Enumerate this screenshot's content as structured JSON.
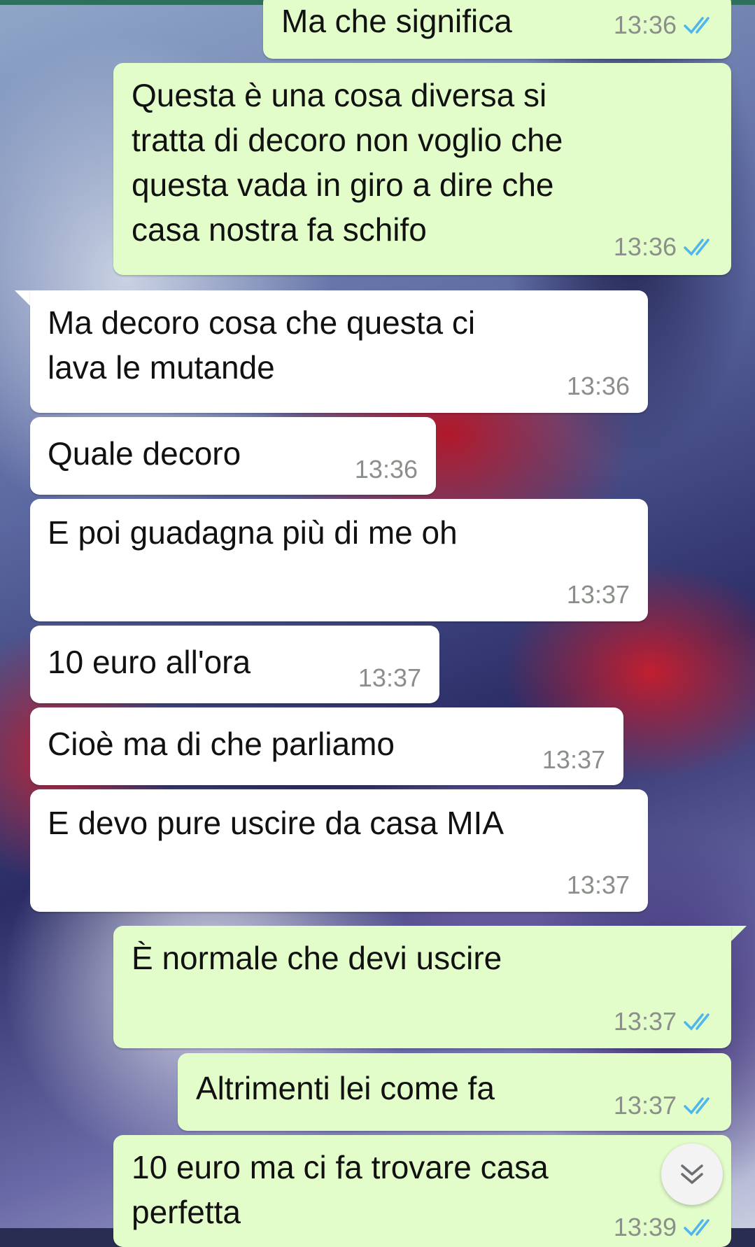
{
  "colors": {
    "outgoing_bubble": "#e2fdca",
    "incoming_bubble": "#ffffff",
    "read_ticks": "#4fb6ec",
    "timestamp": "#8b8f8a"
  },
  "messages": [
    {
      "direction": "out",
      "text": "Ma che significa",
      "time": "13:36",
      "status_icon": "double-check-read-icon"
    },
    {
      "direction": "out",
      "text": "Questa è una cosa diversa si\ntratta di decoro non voglio che\nquesta vada in giro a dire che\ncasa nostra fa schifo",
      "time": "13:36",
      "status_icon": "double-check-read-icon"
    },
    {
      "direction": "in",
      "text": "Ma decoro cosa che questa ci\nlava le mutande",
      "time": "13:36"
    },
    {
      "direction": "in",
      "text": "Quale decoro",
      "time": "13:36"
    },
    {
      "direction": "in",
      "text": "E poi guadagna più di me oh",
      "time": "13:37"
    },
    {
      "direction": "in",
      "text": "10 euro all'ora",
      "time": "13:37"
    },
    {
      "direction": "in",
      "text": "Cioè ma di che parliamo",
      "time": "13:37"
    },
    {
      "direction": "in",
      "text": "E devo pure uscire da casa MIA",
      "time": "13:37"
    },
    {
      "direction": "out",
      "text": "È normale che devi uscire",
      "time": "13:37",
      "status_icon": "double-check-read-icon"
    },
    {
      "direction": "out",
      "text": "Altrimenti lei come fa",
      "time": "13:37",
      "status_icon": "double-check-read-icon"
    },
    {
      "direction": "out",
      "text": "10 euro ma ci fa trovare casa\nperfetta",
      "time": "13:39",
      "status_icon": "double-check-read-icon"
    }
  ],
  "scroll_down_button": {
    "icon": "double-chevron-down-icon"
  }
}
